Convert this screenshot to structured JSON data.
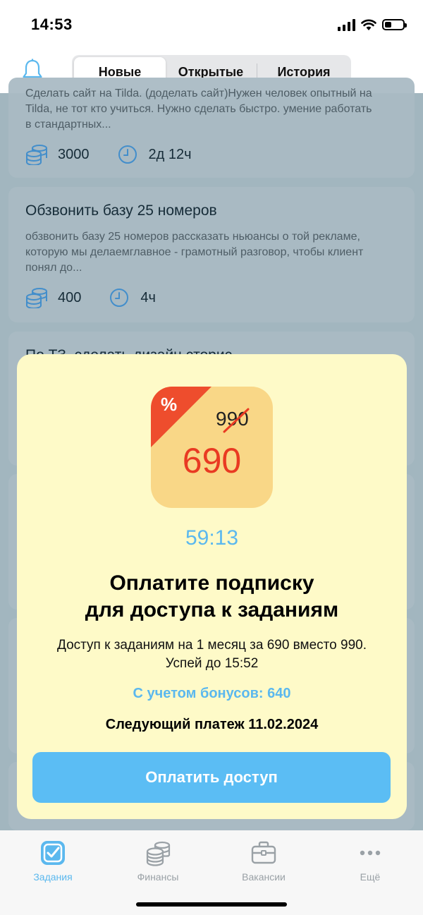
{
  "status_bar": {
    "time": "14:53",
    "icons": [
      "cellular-signal-icon",
      "wifi-icon",
      "battery-icon"
    ]
  },
  "header": {
    "bell_icon": "bell-icon",
    "tabs": [
      {
        "label": "Новые",
        "active": true
      },
      {
        "label": "Открытые",
        "active": false
      },
      {
        "label": "История",
        "active": false
      }
    ]
  },
  "tasks": [
    {
      "title": "",
      "description": "Сделать сайт на Tilda. (доделать сайт)Нужен человек опытный на Tilda, не тот кто учиться. Нужно сделать быстро. умение работать в стандартных...",
      "price": "3000",
      "duration": "2д 12ч"
    },
    {
      "title": "Обзвонить базу 25 номеров",
      "description": "обзвонить базу 25 номеров рассказать ньюансы о той рекламе, которую мы делаемглавное - грамотный разговор, чтобы клиент понял до...",
      "price": "400",
      "duration": "4ч"
    },
    {
      "title": "По ТЗ, сделать дизайн сторис",
      "description": "",
      "price": "",
      "duration": ""
    }
  ],
  "modal": {
    "badge": {
      "percent_symbol": "%",
      "old_price": "990",
      "new_price": "690"
    },
    "timer": "59:13",
    "title_line1": "Оплатите подписку",
    "title_line2": "для доступа к заданиям",
    "description": "Доступ к заданиям на 1 месяц за 690 вместо 990. Успей до 15:52",
    "bonus": "С учетом бонусов: 640",
    "next_payment": "Следующий платеж 11.02.2024",
    "pay_button": "Оплатить доступ"
  },
  "tabbar": {
    "items": [
      {
        "label": "Задания",
        "icon": "tasks-checkbox-icon",
        "active": true
      },
      {
        "label": "Финансы",
        "icon": "coins-icon",
        "active": false
      },
      {
        "label": "Вакансии",
        "icon": "briefcase-icon",
        "active": false
      },
      {
        "label": "Ещё",
        "icon": "more-dots-icon",
        "active": false
      }
    ]
  },
  "colors": {
    "accent": "#5bb8ee",
    "modal_bg": "#fefac8",
    "badge_bg": "#f9d787",
    "discount_red": "#ee4d2d"
  }
}
